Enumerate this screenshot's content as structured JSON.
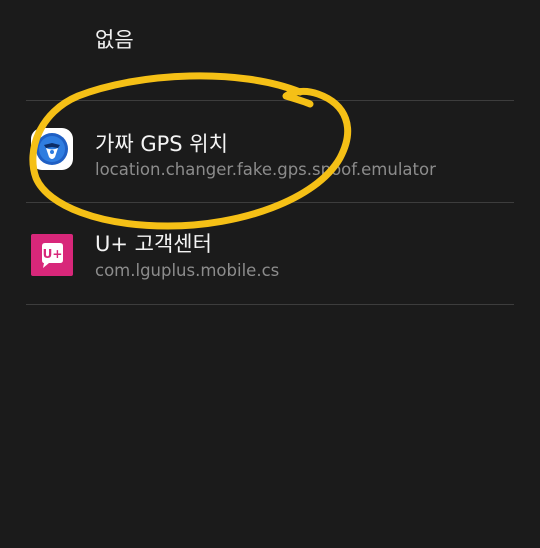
{
  "list": {
    "none_option": {
      "label": "없음"
    },
    "apps": [
      {
        "name": "가짜 GPS 위치",
        "package": "location.changer.fake.gps.spoof.emulator",
        "icon": "fake-gps-app-icon"
      },
      {
        "name": "U+ 고객센터",
        "package": "com.lguplus.mobile.cs",
        "icon": "lguplus-app-icon",
        "icon_text": "U+"
      }
    ]
  },
  "colors": {
    "background": "#1b1b1b",
    "divider": "#3d3d3d",
    "secondary_text": "#8c8c8c",
    "annotation_circle": "#f5c016",
    "lguplus_brand": "#d8277a"
  }
}
